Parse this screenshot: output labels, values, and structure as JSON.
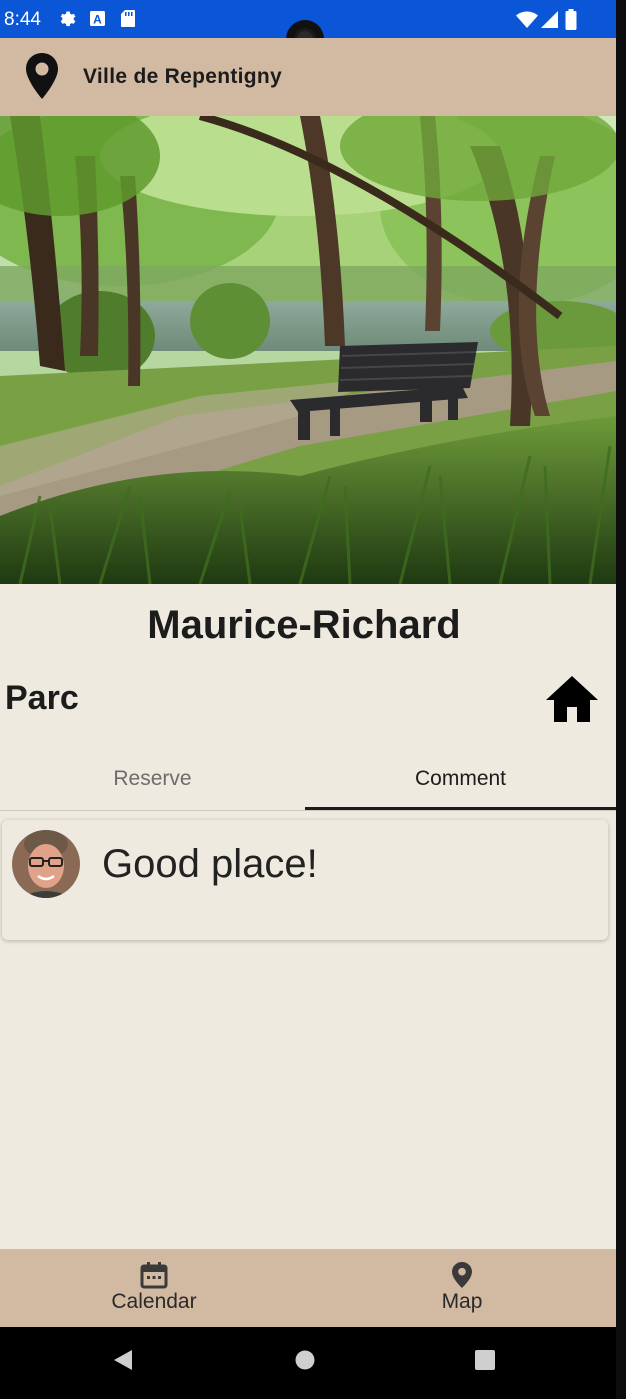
{
  "status_bar": {
    "time": "8:44",
    "icons": [
      "settings-icon",
      "a-icon",
      "sd-card-icon",
      "wifi-icon",
      "signal-icon",
      "battery-icon"
    ]
  },
  "app_bar": {
    "icon": "location-pin-icon",
    "title": "Ville de Repentigny"
  },
  "place": {
    "name": "Maurice-Richard",
    "category": "Parc",
    "category_icon": "home-icon"
  },
  "tabs": [
    {
      "label": "Reserve",
      "selected": false
    },
    {
      "label": "Comment",
      "selected": true
    }
  ],
  "comments": [
    {
      "text": "Good place!",
      "avatar": "user-avatar"
    }
  ],
  "bottom_nav": [
    {
      "label": "Calendar",
      "icon": "calendar-icon"
    },
    {
      "label": "Map",
      "icon": "map-pin-icon"
    }
  ],
  "system_nav": [
    "back-icon",
    "home-circle-icon",
    "recents-icon"
  ],
  "colors": {
    "status_bar": "#0a56d6",
    "app_bar": "#d2b9a2",
    "background": "#eeeae0",
    "text": "#1c1c1c"
  }
}
